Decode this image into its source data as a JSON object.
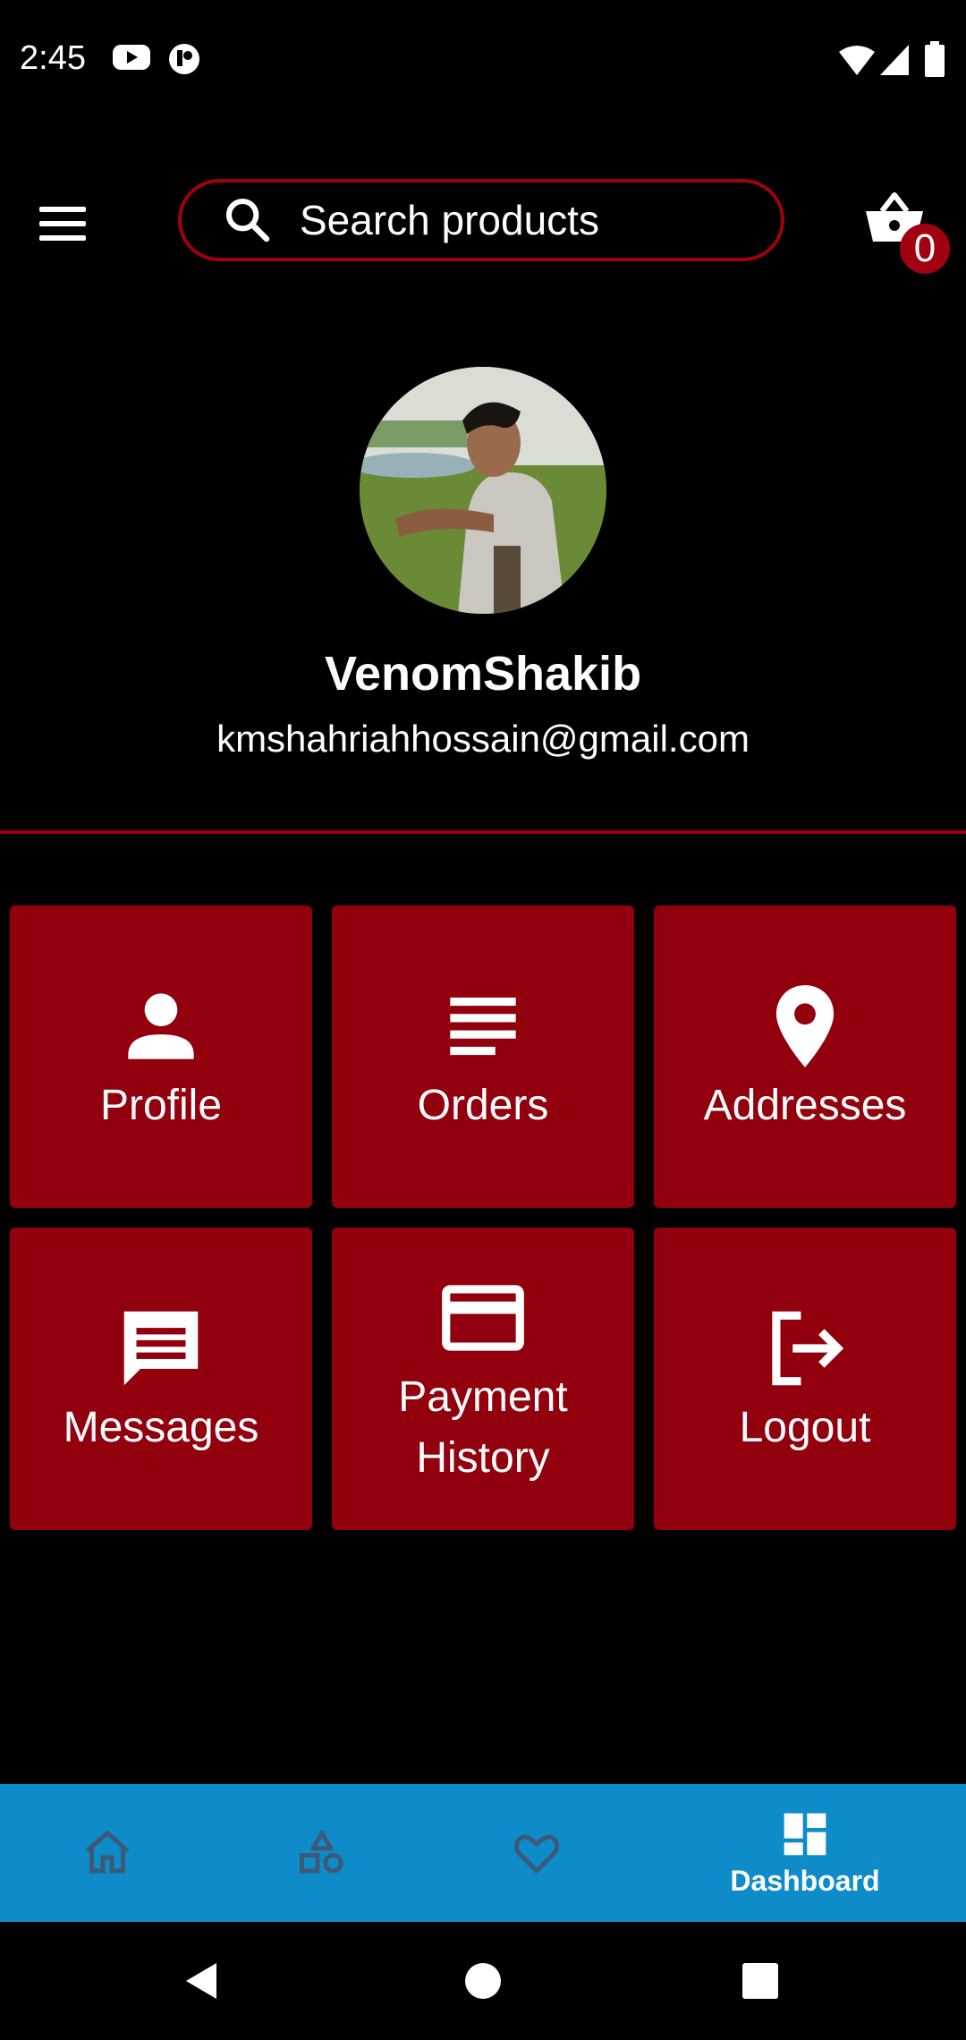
{
  "status_bar": {
    "time": "2:45",
    "icons": [
      "youtube-icon",
      "app-icon",
      "wifi-icon",
      "signal-icon",
      "battery-icon"
    ]
  },
  "header": {
    "search_placeholder": "Search products",
    "cart_count": "0"
  },
  "user": {
    "name": "VenomShakib",
    "email": "kmshahriahhossain@gmail.com"
  },
  "tiles": [
    {
      "label": "Profile",
      "icon": "person-icon"
    },
    {
      "label": "Orders",
      "icon": "list-icon"
    },
    {
      "label": "Addresses",
      "icon": "location-pin-icon"
    },
    {
      "label": "Messages",
      "icon": "message-icon"
    },
    {
      "label": "Payment History",
      "icon": "credit-card-icon"
    },
    {
      "label": "Logout",
      "icon": "logout-icon"
    }
  ],
  "bottom_nav": {
    "items": [
      {
        "icon": "home-icon",
        "label": ""
      },
      {
        "icon": "categories-icon",
        "label": ""
      },
      {
        "icon": "heart-icon",
        "label": ""
      },
      {
        "icon": "dashboard-icon",
        "label": "Dashboard",
        "active": true
      }
    ]
  },
  "colors": {
    "accent": "#92000e",
    "nav_bar": "#0d8cc9",
    "background": "#000000"
  }
}
